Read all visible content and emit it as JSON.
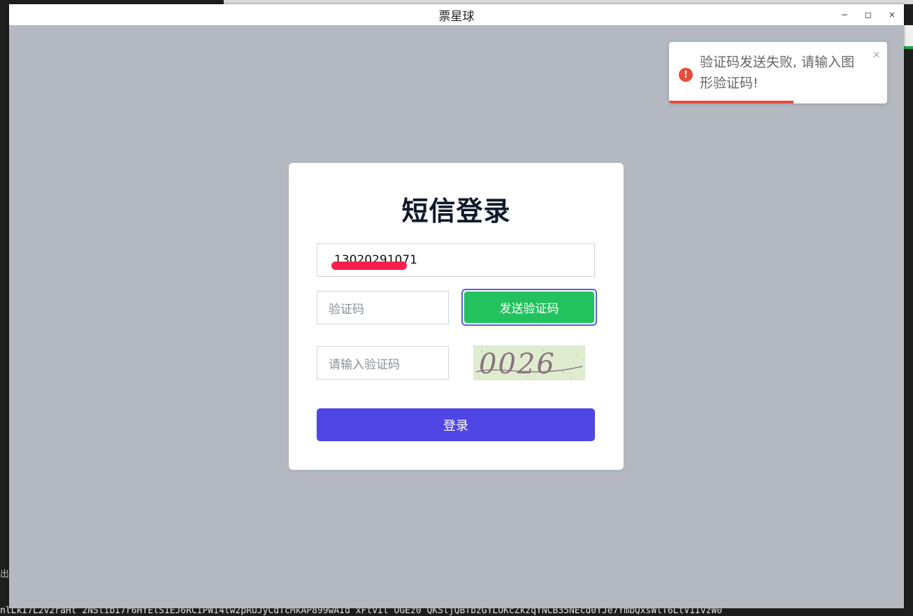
{
  "window": {
    "title": "票星球",
    "minimize": "−",
    "maximize": "◻",
    "close": "×"
  },
  "background": {
    "left_edge_text": "出",
    "bottom_text": "nlLkI7L2v2raHt 2NSlibI7r6HYElS1EJ6RCiPWi4tw2pRUJyCdTcMkAP899wAId xFtvIl OGEz0 QKSljQBTbzGYLOKcZkzqYNCB35NEcd0YJe7YmbQxsWlT6LtV1IvzW0"
  },
  "login": {
    "title": "短信登录",
    "phone_value": "13020291071",
    "phone_visible_tail": "71",
    "sms_code_placeholder": "验证码",
    "send_code_label": "发送验证码",
    "captcha_placeholder": "请输入验证码",
    "captcha_text": "0026",
    "login_label": "登录"
  },
  "toast": {
    "type": "error",
    "icon": "!",
    "message": "验证码发送失败, 请输入图形验证码!",
    "close": "×",
    "progress": 0.57
  },
  "colors": {
    "primary": "#4f46e5",
    "success": "#22c35e",
    "error": "#e74c3c",
    "overlay": "#b3b8c1"
  }
}
